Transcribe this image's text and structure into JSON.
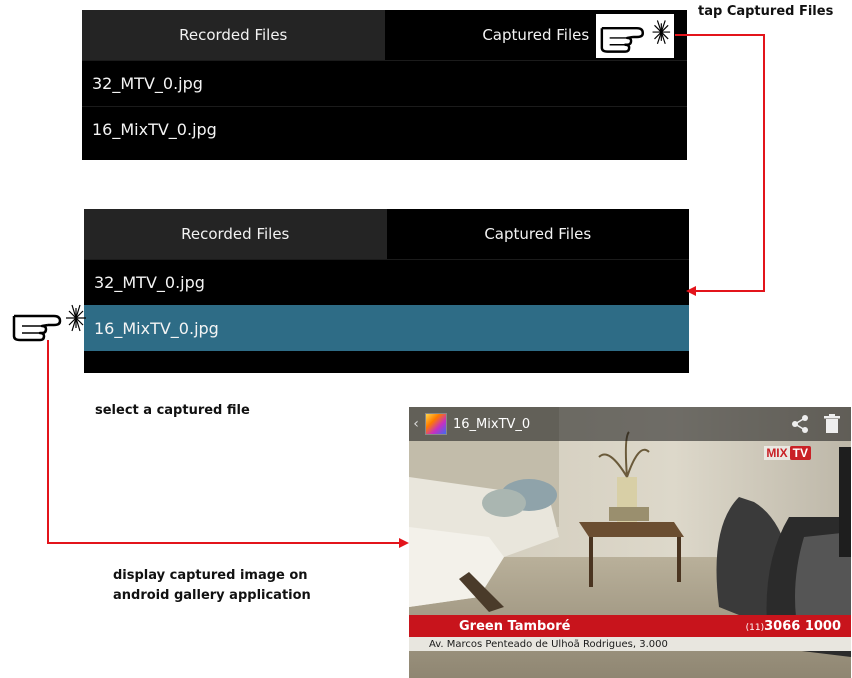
{
  "tabs": {
    "recorded": "Recorded Files",
    "captured": "Captured Files"
  },
  "files": [
    {
      "name": "32_MTV_0.jpg"
    },
    {
      "name": "16_MixTV_0.jpg"
    }
  ],
  "annotations": {
    "tap": "tap Captured Files",
    "select": "select a captured file",
    "display_line1": "display captured image on",
    "display_line2": "android gallery application"
  },
  "gallery": {
    "title": "16_MixTV_0",
    "icons": [
      "back-chevron-icon",
      "gallery-app-icon",
      "share-icon",
      "trash-icon"
    ],
    "channel_logo_mix": "MIX",
    "channel_logo_tv": "TV",
    "lower_third_name": "Green Tamboré",
    "lower_third_area_code": "(11)",
    "lower_third_phone": "3066 1000",
    "address": "Av. Marcos Penteado de Ulhoã Rodrigues, 3.000"
  },
  "colors": {
    "selected_row": "#2e6c86",
    "annotation_line": "#e3141b",
    "inactive_tab": "#242424"
  }
}
